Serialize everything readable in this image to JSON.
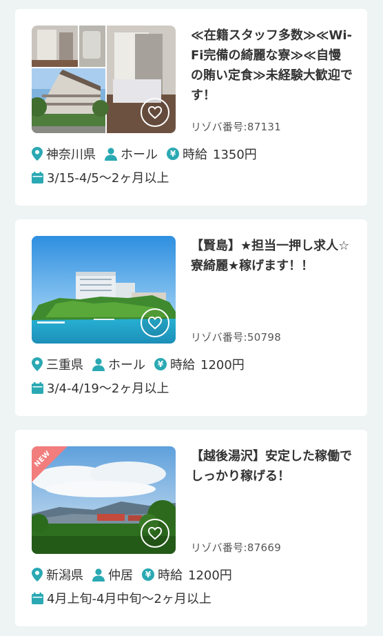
{
  "colors": {
    "accent": "#2aa9b3",
    "new_badge": "#f27d7d",
    "text": "#333333",
    "background": "#eef3f4"
  },
  "jobs": [
    {
      "title": "≪在籍スタッフ多数≫≪Wi-Fi完備の綺麗な寮≫≪自慢の賄い定食≫未経験大歓迎です！",
      "rizoba_no": "リゾバ番号:87131",
      "location": "神奈川県",
      "position": "ホール",
      "wage_label": "時給",
      "wage": "1350円",
      "period": "3/15-4/5〜2ヶ月以上",
      "is_new": false,
      "icons": [
        "map-pin-icon",
        "person-icon",
        "yen-icon",
        "calendar-icon",
        "heart-icon"
      ]
    },
    {
      "title": "【賢島】★担当一押し求人☆寮綺麗★稼げます！！",
      "rizoba_no": "リゾバ番号:50798",
      "location": "三重県",
      "position": "ホール",
      "wage_label": "時給",
      "wage": "1200円",
      "period": "3/4-4/19〜2ヶ月以上",
      "is_new": false
    },
    {
      "title": "【越後湯沢】安定した稼働でしっかり稼げる！",
      "rizoba_no": "リゾバ番号:87669",
      "location": "新潟県",
      "position": "仲居",
      "wage_label": "時給",
      "wage": "1200円",
      "period": "4月上旬-4月中旬〜2ヶ月以上",
      "is_new": true,
      "badge": "NEW"
    }
  ]
}
